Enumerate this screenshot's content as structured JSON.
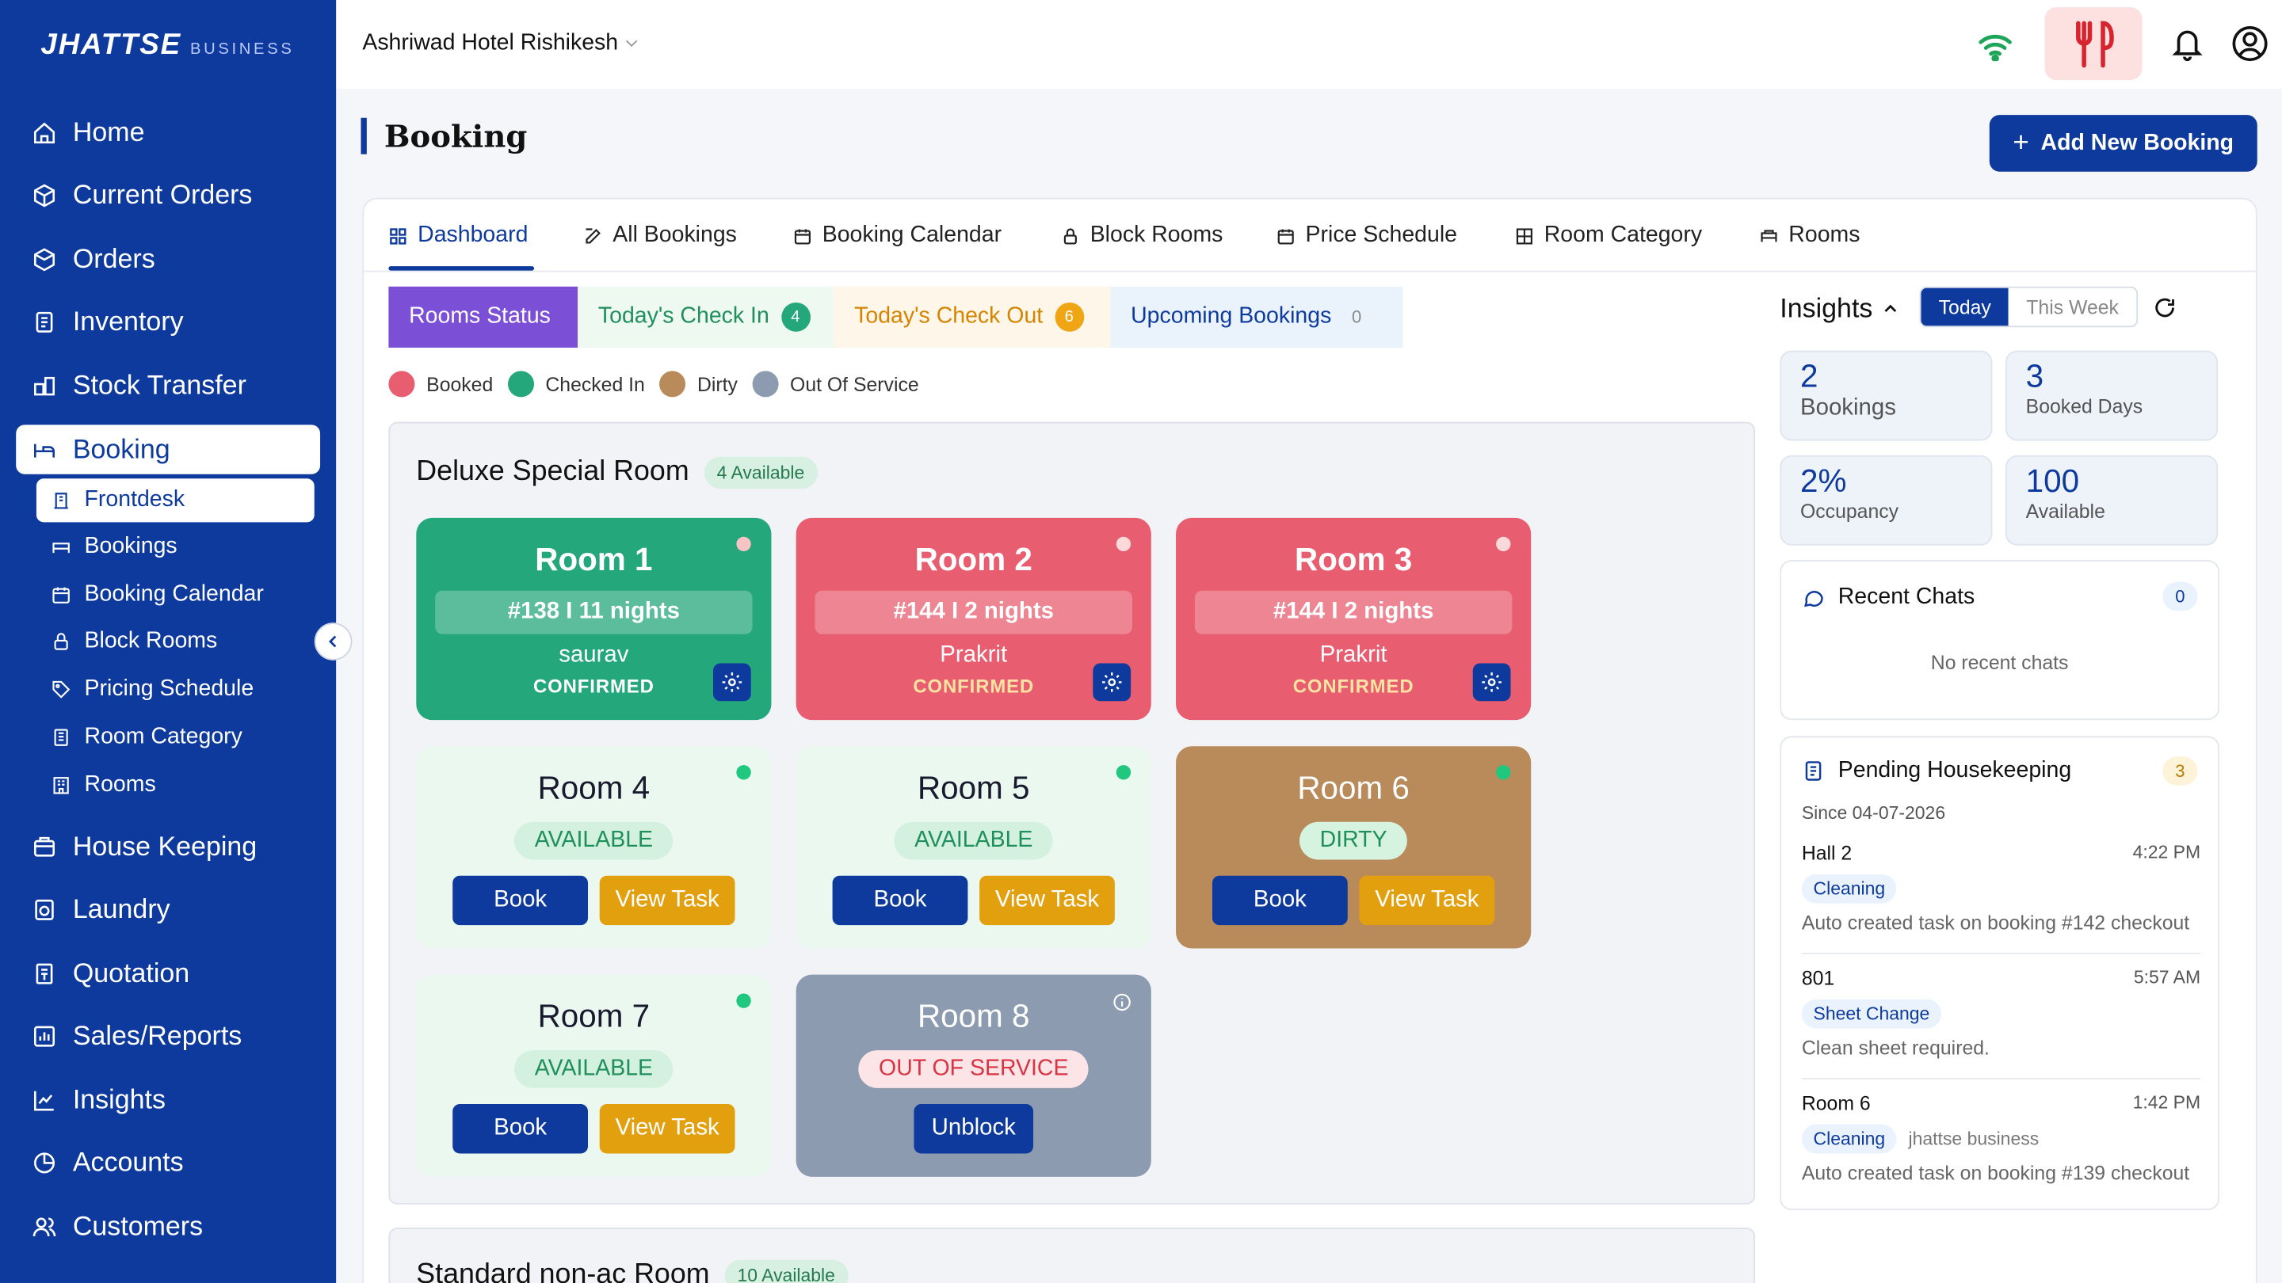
{
  "brand": {
    "name": "JHATTSE",
    "suffix": "BUSINESS"
  },
  "colors": {
    "primary": "#0d3a9c",
    "booked": "#e85d6f",
    "checked_in": "#24a77a",
    "dirty": "#b98a5a",
    "out_of_service": "#8c9bb0",
    "view_task": "#e3a00e"
  },
  "sidebar": {
    "items": [
      {
        "label": "Home",
        "icon": "home-icon"
      },
      {
        "label": "Current Orders",
        "icon": "box-icon"
      },
      {
        "label": "Orders",
        "icon": "package-icon"
      },
      {
        "label": "Inventory",
        "icon": "clipboard-icon"
      },
      {
        "label": "Stock Transfer",
        "icon": "transfer-icon"
      },
      {
        "label": "Booking",
        "icon": "bed-icon"
      },
      {
        "label": "House Keeping",
        "icon": "housekeeping-icon"
      },
      {
        "label": "Laundry",
        "icon": "laundry-icon"
      },
      {
        "label": "Quotation",
        "icon": "quotation-icon"
      },
      {
        "label": "Sales/Reports",
        "icon": "reports-icon"
      },
      {
        "label": "Insights",
        "icon": "insights-icon"
      },
      {
        "label": "Accounts",
        "icon": "accounts-icon"
      },
      {
        "label": "Customers",
        "icon": "customers-icon"
      }
    ],
    "sub_items": [
      {
        "label": "Frontdesk",
        "icon": "frontdesk-icon"
      },
      {
        "label": "Bookings",
        "icon": "bed-icon"
      },
      {
        "label": "Booking Calendar",
        "icon": "calendar-icon"
      },
      {
        "label": "Block Rooms",
        "icon": "lock-icon"
      },
      {
        "label": "Pricing Schedule",
        "icon": "tag-icon"
      },
      {
        "label": "Room Category",
        "icon": "category-icon"
      },
      {
        "label": "Rooms",
        "icon": "rooms-icon"
      }
    ]
  },
  "topbar": {
    "hotel": "Ashriwad Hotel Rishikesh"
  },
  "page": {
    "title": "Booking",
    "add_button": "Add New Booking"
  },
  "tabs": [
    {
      "label": "Dashboard",
      "icon": "dashboard-icon"
    },
    {
      "label": "All Bookings",
      "icon": "edit-icon"
    },
    {
      "label": "Booking Calendar",
      "icon": "calendar-icon"
    },
    {
      "label": "Block Rooms",
      "icon": "lock-icon"
    },
    {
      "label": "Price Schedule",
      "icon": "calendar-icon"
    },
    {
      "label": "Room Category",
      "icon": "grid-icon"
    },
    {
      "label": "Rooms",
      "icon": "bed-icon"
    }
  ],
  "subtabs": {
    "rooms_status": "Rooms Status",
    "checkin": {
      "label": "Today's Check In",
      "count": "4"
    },
    "checkout": {
      "label": "Today's Check Out",
      "count": "6"
    },
    "upcoming": {
      "label": "Upcoming Bookings",
      "count": "0"
    }
  },
  "legend": [
    "Booked",
    "Checked In",
    "Dirty",
    "Out Of Service"
  ],
  "section1": {
    "name": "Deluxe Special Room",
    "available": "4 Available",
    "rooms": [
      {
        "name": "Room 1",
        "booking": "#138 I 11 nights",
        "guest": "saurav",
        "status": "CONFIRMED"
      },
      {
        "name": "Room 2",
        "booking": "#144 I 2 nights",
        "guest": "Prakrit",
        "status": "CONFIRMED"
      },
      {
        "name": "Room 3",
        "booking": "#144 I 2 nights",
        "guest": "Prakrit",
        "status": "CONFIRMED"
      },
      {
        "name": "Room 4",
        "status": "AVAILABLE"
      },
      {
        "name": "Room 5",
        "status": "AVAILABLE"
      },
      {
        "name": "Room 6",
        "status": "DIRTY"
      },
      {
        "name": "Room 7",
        "status": "AVAILABLE"
      },
      {
        "name": "Room 8",
        "status": "OUT OF SERVICE"
      }
    ],
    "book": "Book",
    "view_task": "View Task",
    "unblock": "Unblock"
  },
  "section2": {
    "name": "Standard non-ac Room",
    "available": "10 Available"
  },
  "insights": {
    "title": "Insights",
    "today": "Today",
    "week": "This Week",
    "stats": [
      {
        "value": "2",
        "label": "Bookings"
      },
      {
        "value": "3",
        "label": "Booked Days"
      },
      {
        "value": "2%",
        "label": "Occupancy"
      },
      {
        "value": "100",
        "label": "Available"
      }
    ],
    "chats": {
      "title": "Recent Chats",
      "count": "0",
      "empty": "No recent chats"
    },
    "housekeeping": {
      "title": "Pending Housekeeping",
      "count": "3",
      "since": "Since 04-07-2026",
      "items": [
        {
          "name": "Hall 2",
          "time": "4:22 PM",
          "tag": "Cleaning",
          "by": "",
          "desc": "Auto created task on booking #142 checkout"
        },
        {
          "name": "801",
          "time": "5:57 AM",
          "tag": "Sheet Change",
          "by": "",
          "desc": "Clean sheet required."
        },
        {
          "name": "Room 6",
          "time": "1:42 PM",
          "tag": "Cleaning",
          "by": "jhattse business",
          "desc": "Auto created task on booking #139 checkout"
        }
      ]
    }
  }
}
